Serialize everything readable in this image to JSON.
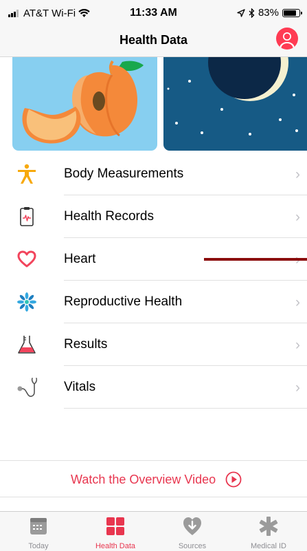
{
  "status_bar": {
    "carrier": "AT&T Wi-Fi",
    "time": "11:33 AM",
    "battery": "83%",
    "battery_level": 0.83
  },
  "nav": {
    "title": "Health Data"
  },
  "categories": [
    {
      "label": "Body Measurements",
      "icon": "figure-icon",
      "color": "#f7a90c"
    },
    {
      "label": "Health Records",
      "icon": "clipboard-icon",
      "color": "#f2445c"
    },
    {
      "label": "Heart",
      "icon": "heart-icon",
      "color": "#f2445c"
    },
    {
      "label": "Reproductive Health",
      "icon": "snowflake-flower-icon",
      "color": "#34a8e0"
    },
    {
      "label": "Results",
      "icon": "flask-icon",
      "color": "#f2445c"
    },
    {
      "label": "Vitals",
      "icon": "stethoscope-icon",
      "color": "#9b9b9b"
    }
  ],
  "video": {
    "label": "Watch the Overview Video"
  },
  "tabs": [
    {
      "label": "Today",
      "icon": "calendar-icon",
      "active": false
    },
    {
      "label": "Health Data",
      "icon": "grid-icon",
      "active": true
    },
    {
      "label": "Sources",
      "icon": "heart-download-icon",
      "active": false
    },
    {
      "label": "Medical ID",
      "icon": "asterisk-icon",
      "active": false
    }
  ],
  "colors": {
    "accent": "#e8364f",
    "annotation": "#8b0b0b"
  }
}
